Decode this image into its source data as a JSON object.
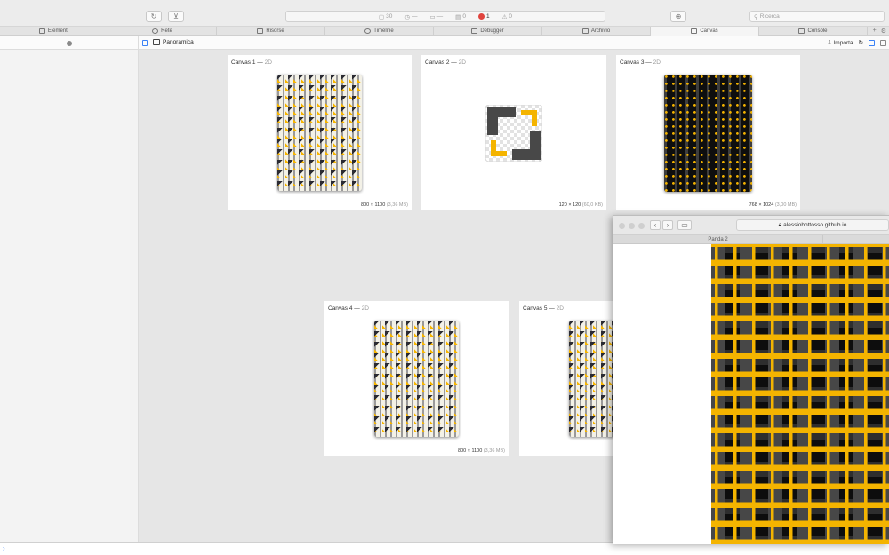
{
  "toolbar": {
    "reload_icon": "reload-icon",
    "download_icon": "download-icon",
    "status": {
      "resources_count": "30",
      "item2": "—",
      "item3": "—",
      "item4": "0",
      "errors": "1",
      "warnings": "0"
    },
    "target_icon": "crosshair-icon",
    "search_placeholder": "Ricerca"
  },
  "tabs": [
    {
      "label": "Elementi",
      "icon": "elements-icon"
    },
    {
      "label": "Rete",
      "icon": "network-icon"
    },
    {
      "label": "Risorse",
      "icon": "resources-icon"
    },
    {
      "label": "Timeline",
      "icon": "timeline-icon"
    },
    {
      "label": "Debugger",
      "icon": "debugger-icon"
    },
    {
      "label": "Archivio",
      "icon": "storage-icon"
    },
    {
      "label": "Canvas",
      "icon": "canvas-icon",
      "active": true
    },
    {
      "label": "Console",
      "icon": "console-icon"
    }
  ],
  "subbar": {
    "breadcrumb": "Panoramica",
    "import_label": "Importa"
  },
  "canvases": [
    {
      "title": "Canvas 1",
      "type": "2D",
      "dims": "800 × 1100",
      "size": "(3,36 MB)"
    },
    {
      "title": "Canvas 2",
      "type": "2D",
      "dims": "120 × 120",
      "size": "(60,0 KB)"
    },
    {
      "title": "Canvas 3",
      "type": "2D",
      "dims": "768 × 1024",
      "size": "(3,00 MB)"
    },
    {
      "title": "Canvas 4",
      "type": "2D",
      "dims": "800 × 1100",
      "size": "(3,36 MB)"
    },
    {
      "title": "Canvas 5",
      "type": "2D"
    }
  ],
  "safari": {
    "url": "alessiobottosso.github.io",
    "tab_title": "Panda 2"
  },
  "colors": {
    "accent": "#3b82f6",
    "error": "#e0443e",
    "yellow": "#f4b400"
  }
}
